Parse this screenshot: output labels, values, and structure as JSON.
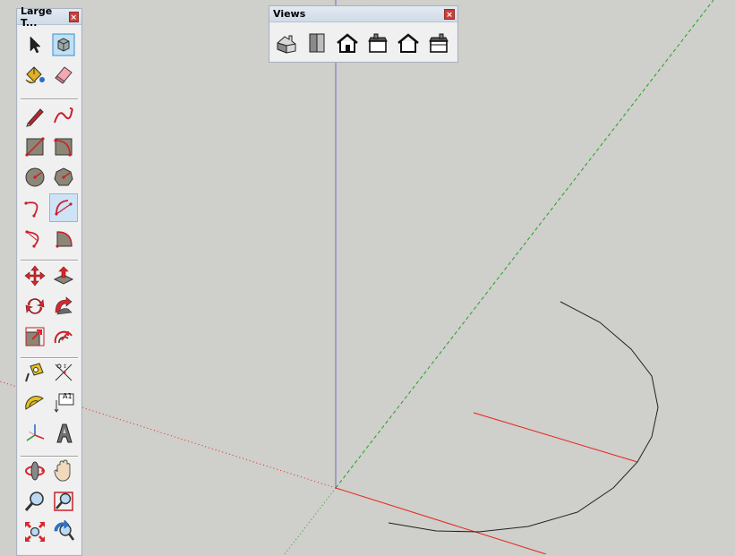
{
  "palette": {
    "title": "Large T...",
    "close_label": "×"
  },
  "views": {
    "title": "Views",
    "close_label": "×"
  },
  "tools": {
    "text_label": "A1"
  },
  "colors": {
    "axis_red": "#e8211b",
    "axis_green": "#21a121",
    "axis_blue": "#6e6ecc",
    "arc_stroke": "#222222",
    "active_tool": "#cfe3f7"
  }
}
